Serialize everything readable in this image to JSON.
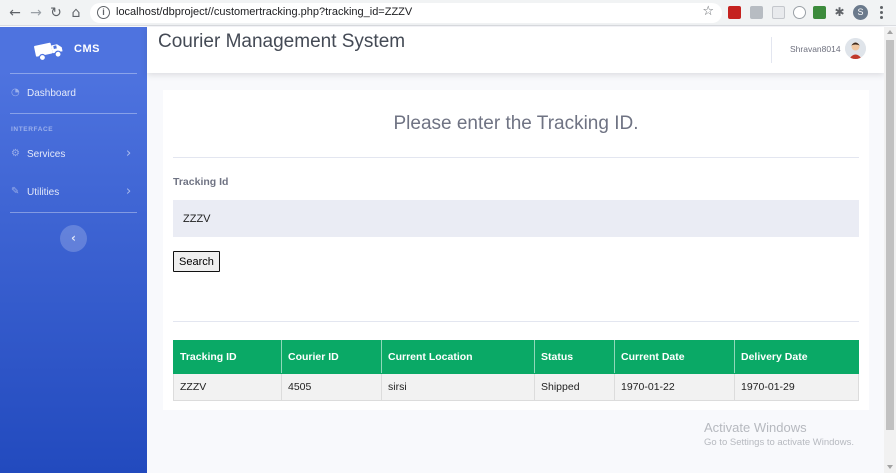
{
  "browser": {
    "url": "localhost/dbproject//customertracking.php?tracking_id=ZZZV",
    "profile_initial": "S",
    "icons": [
      "back-icon",
      "forward-icon",
      "reload-icon",
      "home-icon",
      "info-icon",
      "star-icon",
      "extension-icon",
      "kebab-menu-icon"
    ]
  },
  "sidebar": {
    "brand": "CMS",
    "dashboard_label": "Dashboard",
    "section_heading": "INTERFACE",
    "items": [
      {
        "label": "Services",
        "icon": "gear-icon"
      },
      {
        "label": "Utilities",
        "icon": "wrench-icon"
      }
    ],
    "toggle_icon": "chevron-left-icon",
    "gradient": [
      "#4e73df",
      "#224abe"
    ]
  },
  "topbar": {
    "title": "Courier Management System",
    "username": "Shravan8014"
  },
  "main": {
    "prompt": "Please enter the Tracking ID.",
    "field_label": "Tracking Id",
    "tracking_value": "ZZZV",
    "search_label": "Search",
    "table": {
      "headers": [
        "Tracking ID",
        "Courier ID",
        "Current Location",
        "Status",
        "Current Date",
        "Delivery Date"
      ],
      "rows": [
        [
          "ZZZV",
          "4505",
          "sirsi",
          "Shipped",
          "1970-01-22",
          "1970-01-29"
        ]
      ],
      "header_color": "#0aa966"
    }
  },
  "watermark": {
    "line1": "Activate Windows",
    "line2": "Go to Settings to activate Windows."
  }
}
